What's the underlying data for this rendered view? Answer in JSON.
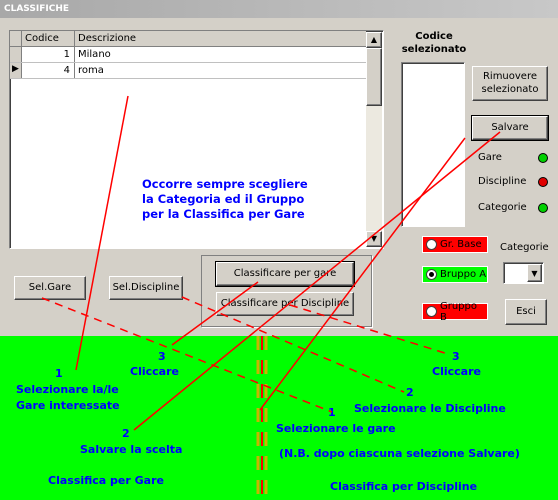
{
  "window": {
    "title": "CLASSIFICHE"
  },
  "grid": {
    "columns": {
      "code": "Codice",
      "description": "Descrizione"
    },
    "rows": [
      {
        "code": "1",
        "description": "Milano",
        "current": false
      },
      {
        "code": "4",
        "description": "roma",
        "current": true
      }
    ]
  },
  "selected_panel": {
    "label": "Codice selezionato"
  },
  "buttons": {
    "remove_selected": "Rimuovere selezionato",
    "save": "Salvare",
    "sel_gare": "Sel.Gare",
    "sel_discipline": "Sel.Discipline",
    "classify_gare": "Classificare per gare",
    "classify_discipline": "Classificare per Discipline",
    "exit": "Esci"
  },
  "status": [
    {
      "label": "Gare",
      "color": "#00d000"
    },
    {
      "label": "Discipline",
      "color": "#e00000"
    },
    {
      "label": "Categorie",
      "color": "#00d000"
    }
  ],
  "groups": [
    {
      "label": "Gr. Base",
      "selected": false,
      "bg": "#ff0000"
    },
    {
      "label": "Bruppo A",
      "selected": true,
      "bg": "#00ff00"
    },
    {
      "label": "Gruppo B",
      "selected": false,
      "bg": "#ff0000"
    }
  ],
  "categorie": {
    "label": "Categorie",
    "value": ""
  },
  "note_top": [
    "Occorre sempre scegliere",
    "la Categoria ed il Gruppo",
    "per la Classifica per Gare"
  ],
  "instructions": {
    "step1_gare": [
      "1",
      "Selezionare la/le",
      "Gare interessate"
    ],
    "step2_save": [
      "2",
      "Salvare la scelta"
    ],
    "step3_left": [
      "3",
      "Cliccare"
    ],
    "step3_right": [
      "3",
      "Cliccare"
    ],
    "step2_disc": [
      "2",
      "Selezionare le Discipline"
    ],
    "step1_disc": [
      "1",
      "Selezionare le gare"
    ],
    "nb": "(N.B. dopo ciascuna selezione Salvare)",
    "footer_left": "Classifica per Gare",
    "footer_right": "Classifica per Discipline"
  },
  "colors": {
    "accent_line": "#ff0000",
    "instruction_text": "#0000ff",
    "panel_bg": "#00ff00"
  }
}
